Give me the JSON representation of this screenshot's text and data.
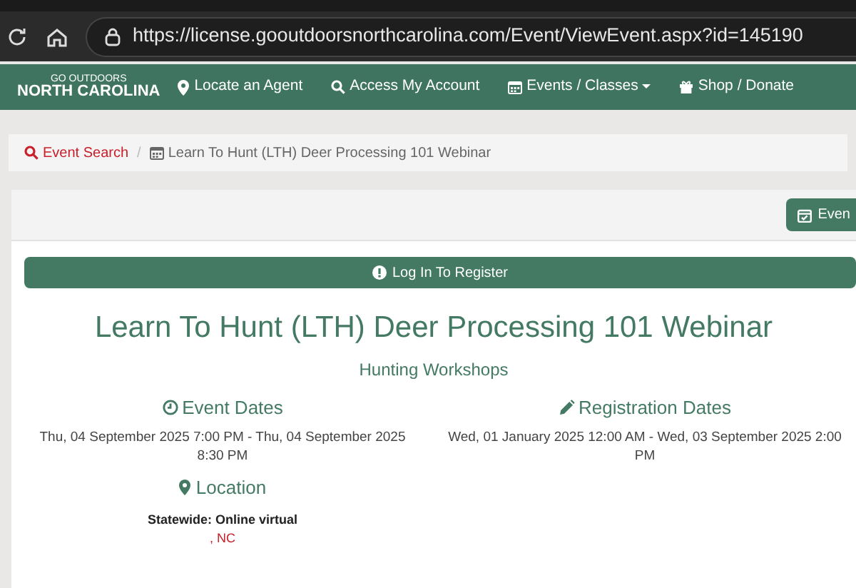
{
  "browser": {
    "url": "https://license.gooutdoorsnorthcarolina.com/Event/ViewEvent.aspx?id=145190"
  },
  "nav": {
    "logo_top": "GO OUTDOORS",
    "logo_bottom": "NORTH CAROLINA",
    "items": [
      {
        "kind": "pin",
        "label": "Locate an Agent"
      },
      {
        "kind": "search",
        "label": "Access My Account"
      },
      {
        "kind": "calendar",
        "label": "Events / Classes",
        "dropdown": true
      },
      {
        "kind": "gift",
        "label": "Shop / Donate"
      }
    ]
  },
  "breadcrumb_separator": "/",
  "breadcrumb": [
    {
      "label": "Event Search",
      "link": true
    },
    {
      "label": "Learn To Hunt (LTH) Deer Processing 101 Webinar",
      "link": false
    }
  ],
  "header_button": "Even",
  "register_button": "Log In To Register",
  "title": "Learn To Hunt (LTH) Deer Processing 101 Webinar",
  "category": "Hunting Workshops",
  "sections": [
    {
      "kind": "clock",
      "heading": "Event Dates",
      "text": "Thu, 04 September 2025 7:00 PM - Thu, 04 September 2025 8:30 PM"
    },
    {
      "kind": "pencil",
      "heading": "Registration Dates",
      "text": "Wed, 01 January 2025 12:00 AM - Wed, 03 September 2025 2:00 PM"
    },
    {
      "kind": "pin",
      "heading": "Location",
      "text": "Statewide: Online virtual",
      "subtext": ", NC"
    }
  ]
}
